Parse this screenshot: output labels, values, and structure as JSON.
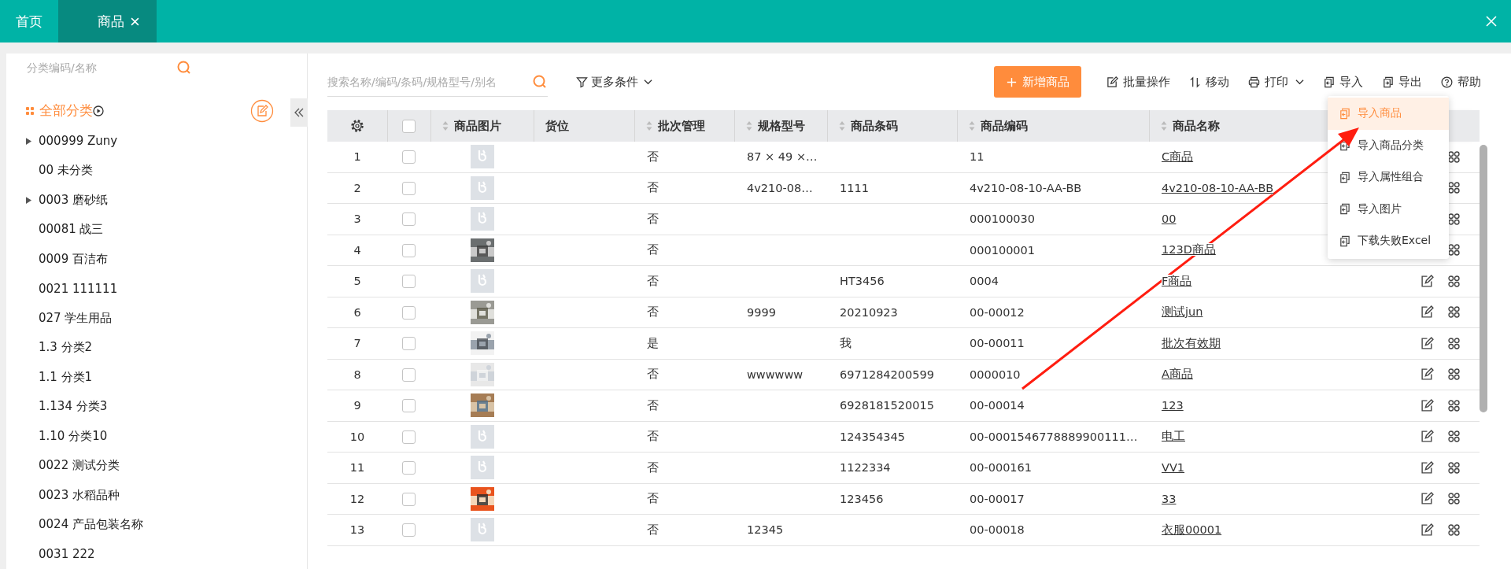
{
  "tabs": [
    {
      "label": "首页",
      "selected": false,
      "closable": false
    },
    {
      "label": "商品",
      "selected": true,
      "closable": true
    }
  ],
  "sidebar": {
    "search_placeholder": "分类编码/名称",
    "root": {
      "label": "全部分类"
    },
    "items": [
      {
        "label": "000999 Zuny",
        "expandable": true
      },
      {
        "label": "00 未分类",
        "expandable": false
      },
      {
        "label": "0003 磨砂纸",
        "expandable": true
      },
      {
        "label": "00081 战三",
        "expandable": false
      },
      {
        "label": "0009 百洁布",
        "expandable": false
      },
      {
        "label": "0021 111111",
        "expandable": false
      },
      {
        "label": "027 学生用品",
        "expandable": false
      },
      {
        "label": "1.3 分类2",
        "expandable": false
      },
      {
        "label": "1.1 分类1",
        "expandable": false
      },
      {
        "label": "1.134 分类3",
        "expandable": false
      },
      {
        "label": "1.10 分类10",
        "expandable": false
      },
      {
        "label": "0022 测试分类",
        "expandable": false
      },
      {
        "label": "0023 水稻品种",
        "expandable": false
      },
      {
        "label": "0024 产品包装名称",
        "expandable": false
      },
      {
        "label": "0031 222",
        "expandable": false
      }
    ]
  },
  "toolbar": {
    "search_placeholder": "搜索名称/编码/条码/规格型号/别名",
    "filter": "更多条件",
    "add_button": "新增商品",
    "actions": [
      {
        "kind": "batch",
        "label": "批量操作",
        "dropdown": false
      },
      {
        "kind": "move",
        "label": "移动",
        "dropdown": false
      },
      {
        "kind": "print",
        "label": "打印",
        "dropdown": true
      },
      {
        "kind": "import",
        "label": "导入",
        "dropdown": false
      },
      {
        "kind": "export",
        "label": "导出",
        "dropdown": false
      },
      {
        "kind": "help",
        "label": "帮助",
        "dropdown": false
      }
    ]
  },
  "table": {
    "columns": [
      {
        "kind": "settings"
      },
      {
        "kind": "checkbox",
        "checked": false
      },
      {
        "kind": "text",
        "label": "商品图片",
        "sortable": true
      },
      {
        "kind": "text",
        "label": "货位",
        "sortable": false
      },
      {
        "kind": "text",
        "label": "批次管理",
        "sortable": true
      },
      {
        "kind": "text",
        "label": "规格型号",
        "sortable": true
      },
      {
        "kind": "text",
        "label": "商品条码",
        "sortable": true
      },
      {
        "kind": "text",
        "label": "商品编码",
        "sortable": true
      },
      {
        "kind": "text",
        "label": "商品名称",
        "sortable": true
      },
      {
        "kind": "actions"
      }
    ],
    "rows": [
      {
        "no": "1",
        "checked": false,
        "kind": "placeholder",
        "batch": "否",
        "spec": "87 × 49 ×…",
        "code": "11",
        "name": "C商品"
      },
      {
        "no": "2",
        "checked": false,
        "kind": "placeholder",
        "batch": "否",
        "spec": "4v210-08…",
        "barcode": "1111",
        "code": "4v210-08-10-AA-BB",
        "name": "4v210-08-10-AA-BB"
      },
      {
        "no": "3",
        "checked": false,
        "kind": "placeholder",
        "batch": "否",
        "code": "000100030",
        "name": "00"
      },
      {
        "no": "4",
        "checked": false,
        "kind": "picture",
        "batch": "否",
        "code": "000100001",
        "name": "123D商品"
      },
      {
        "no": "5",
        "checked": false,
        "kind": "placeholder",
        "batch": "否",
        "barcode": "HT3456",
        "code": "0004",
        "name": "F商品"
      },
      {
        "no": "6",
        "checked": false,
        "kind": "picture",
        "batch": "否",
        "spec": "9999",
        "barcode": "20210923",
        "code": "00-00012",
        "name": "测试jun"
      },
      {
        "no": "7",
        "checked": false,
        "kind": "picture",
        "batch": "是",
        "barcode": "我",
        "code": "00-00011",
        "name": "批次有效期"
      },
      {
        "no": "8",
        "checked": false,
        "kind": "picture",
        "batch": "否",
        "spec": "wwwwww",
        "barcode": "6971284200599",
        "code": "0000010",
        "name": "A商品"
      },
      {
        "no": "9",
        "checked": false,
        "kind": "picture",
        "batch": "否",
        "barcode": "6928181520015",
        "code": "00-00014",
        "name": "123"
      },
      {
        "no": "10",
        "checked": false,
        "kind": "placeholder",
        "batch": "否",
        "barcode": "124354345",
        "code": "00-0001546778889900111…",
        "name": "电工"
      },
      {
        "no": "11",
        "checked": false,
        "kind": "placeholder",
        "batch": "否",
        "barcode": "1122334",
        "code": "00-000161",
        "name": "VV1"
      },
      {
        "no": "12",
        "checked": false,
        "kind": "picture",
        "batch": "否",
        "barcode": "123456",
        "code": "00-00017",
        "name": "33"
      },
      {
        "no": "13",
        "checked": false,
        "kind": "placeholder",
        "batch": "否",
        "spec": "12345",
        "code": "00-00018",
        "name": "衣服00001"
      }
    ]
  },
  "import_menu": {
    "items": [
      {
        "label": "导入商品",
        "selected": true
      },
      {
        "label": "导入商品分类",
        "selected": false
      },
      {
        "label": "导入属性组合",
        "selected": false
      },
      {
        "label": "导入图片",
        "selected": false
      },
      {
        "label": "下载失败Excel",
        "selected": false
      }
    ]
  }
}
